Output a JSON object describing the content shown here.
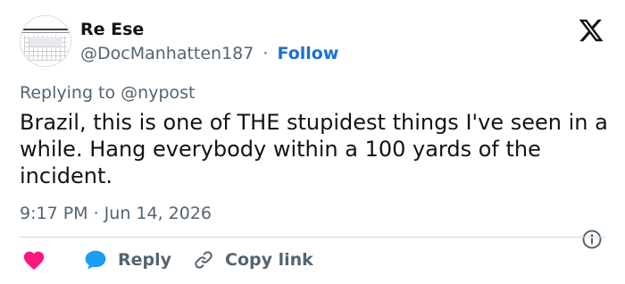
{
  "author": {
    "name": "Re Ese",
    "handle": "@DocManhatten187",
    "separator": "·",
    "follow_label": "Follow"
  },
  "reply_context": "Replying to @nypost",
  "tweet_text": "Brazil, this is one of THE stupidest things I've seen in a while. Hang everybody within a 100 yards of the incident.",
  "timestamp": "9:17 PM · Jun 14, 2026",
  "actions": {
    "reply_label": "Reply",
    "copy_link_label": "Copy link"
  },
  "icons": {
    "logo": "x-logo-icon",
    "info": "info-icon",
    "like": "heart-icon",
    "reply": "speech-bubble-icon",
    "copy": "link-icon"
  },
  "colors": {
    "text": "#0f1419",
    "secondary": "#536471",
    "link": "#1d6fd8",
    "heart": "#f91880",
    "reply_bubble": "#1d9bf0",
    "divider": "#cfd9de"
  }
}
